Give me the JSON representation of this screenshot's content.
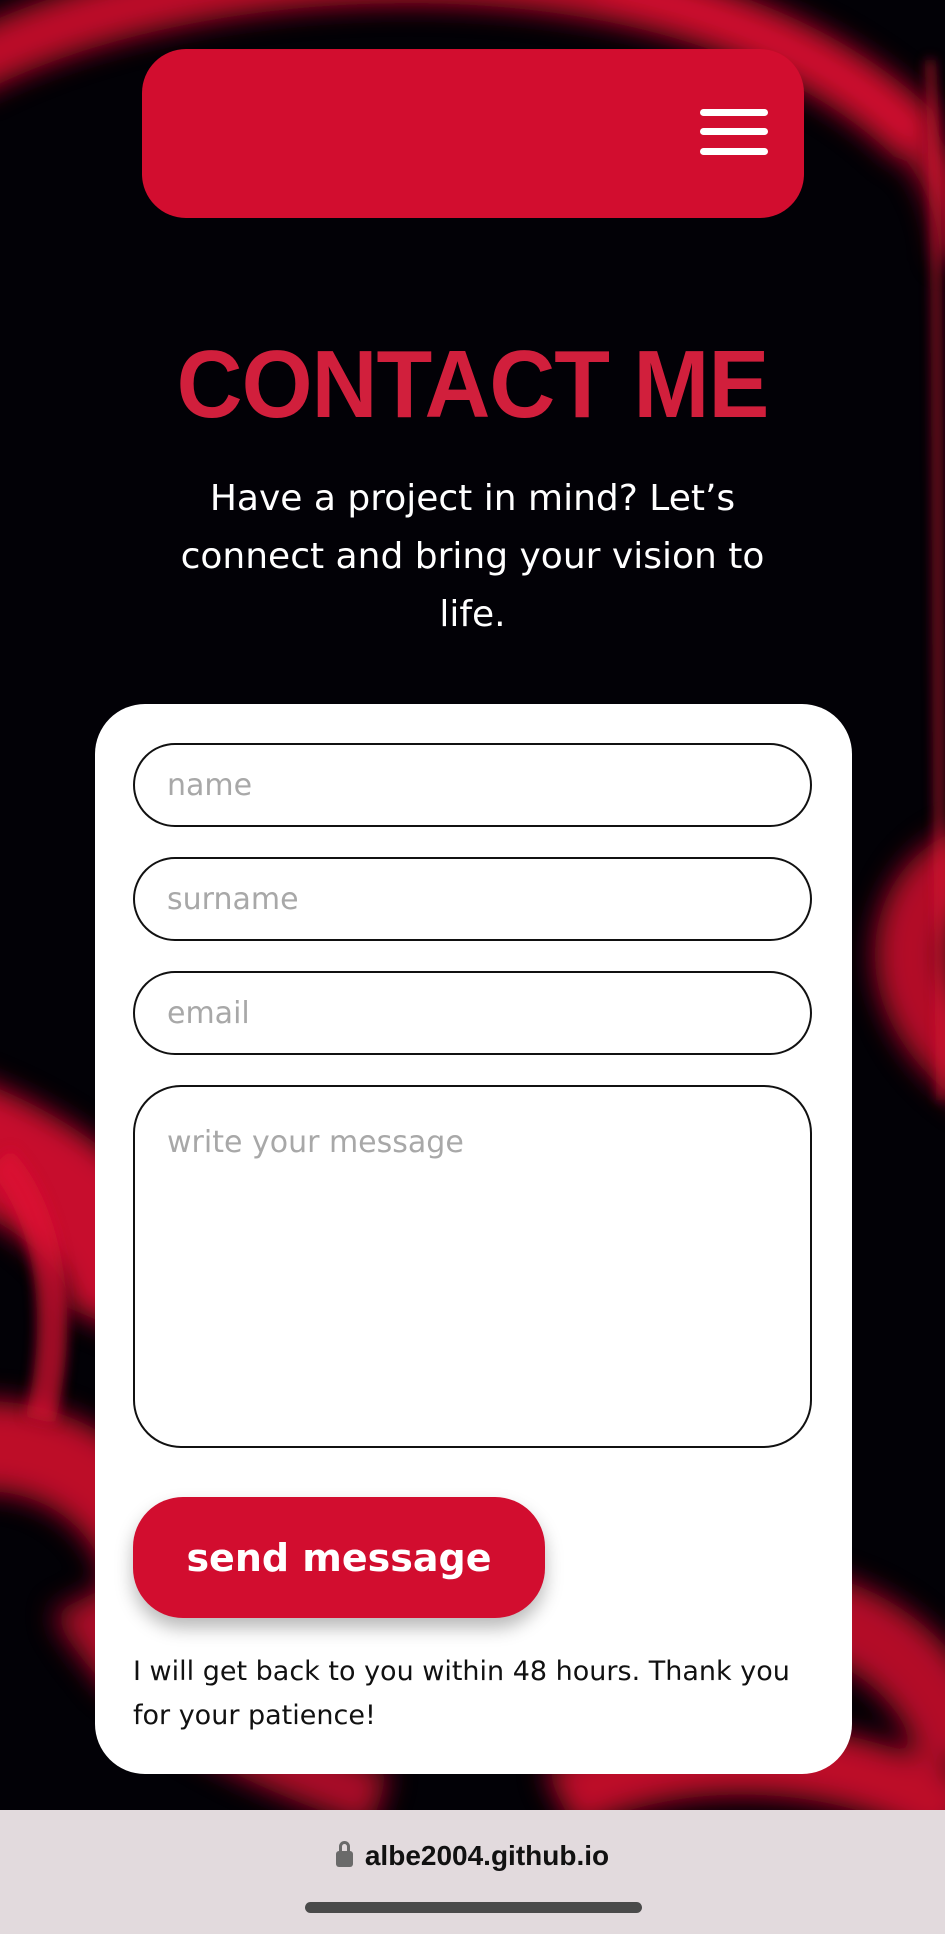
{
  "colors": {
    "accent": "#d20d2f",
    "title": "#d11f3c",
    "background": "#020106",
    "card": "#ffffff",
    "url_bar": "#e2dadd"
  },
  "header": {
    "menu_icon": "hamburger-menu-icon"
  },
  "hero": {
    "title": "CONTACT ME",
    "subtitle": "Have a project in mind? Let’s connect and bring your vision to life."
  },
  "form": {
    "name_placeholder": "name",
    "surname_placeholder": "surname",
    "email_placeholder": "email",
    "message_placeholder": "write your message",
    "send_label": "send message",
    "note": "I will get back to you within 48 hours. Thank you for your patience!"
  },
  "browser": {
    "url": "albe2004.github.io",
    "lock_icon": "lock-icon"
  }
}
